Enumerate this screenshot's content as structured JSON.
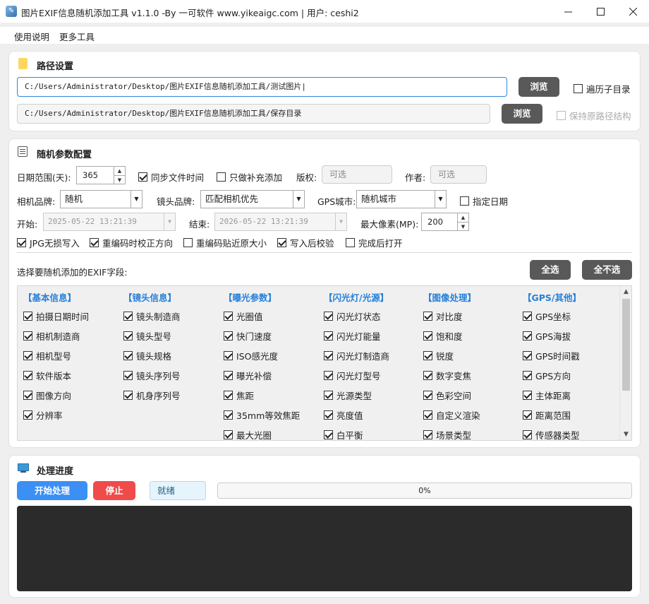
{
  "window": {
    "title": "图片EXIF信息随机添加工具 v1.1.0 -By 一可软件 www.yikeaigc.com  |  用户: ceshi2"
  },
  "menu": [
    "使用说明",
    "更多工具"
  ],
  "path_section": {
    "title": "路径设置",
    "input_path": "C:/Users/Administrator/Desktop/图片EXIF信息随机添加工具/测试图片|",
    "output_path": "C:/Users/Administrator/Desktop/图片EXIF信息随机添加工具/保存目录",
    "browse_label": "浏览",
    "browse2_label": "浏览",
    "traverse_label": "遍历子目录",
    "keep_structure_label": "保持原路径结构"
  },
  "params_section": {
    "title": "随机参数配置",
    "date_range_label": "日期范围(天):",
    "date_range_value": "365",
    "sync_file_time_label": "同步文件时间",
    "only_fill_label": "只做补充添加",
    "copyright_label": "版权:",
    "copyright_placeholder": "可选",
    "author_label": "作者:",
    "author_placeholder": "可选",
    "camera_brand_label": "相机品牌:",
    "camera_brand_value": "随机",
    "lens_brand_label": "镜头品牌:",
    "lens_brand_value": "匹配相机优先",
    "gps_city_label": "GPS城市:",
    "gps_city_value": "随机城市",
    "specify_date_label": "指定日期",
    "start_label": "开始:",
    "start_value": "2025-05-22 13:21:39",
    "end_label": "结束:",
    "end_value": "2026-05-22 13:21:39",
    "max_pixels_label": "最大像素(MP):",
    "max_pixels_value": "200",
    "opt_jpg_lossless": "JPG无损写入",
    "opt_reencode_orient": "重编码时校正方向",
    "opt_reencode_size": "重编码贴近原大小",
    "opt_verify": "写入后校验",
    "opt_open_after": "完成后打开",
    "fields_prompt": "选择要随机添加的EXIF字段:",
    "select_all": "全选",
    "select_none": "全不选"
  },
  "field_columns": [
    {
      "header": "【基本信息】",
      "items": [
        "拍摄日期时间",
        "相机制造商",
        "相机型号",
        "软件版本",
        "图像方向",
        "分辨率"
      ]
    },
    {
      "header": "【镜头信息】",
      "items": [
        "镜头制造商",
        "镜头型号",
        "镜头规格",
        "镜头序列号",
        "机身序列号"
      ]
    },
    {
      "header": "【曝光参数】",
      "items": [
        "光圈值",
        "快门速度",
        "ISO感光度",
        "曝光补偿",
        "焦距",
        "35mm等效焦距",
        "最大光圈"
      ]
    },
    {
      "header": "【闪光灯/光源】",
      "items": [
        "闪光灯状态",
        "闪光灯能量",
        "闪光灯制造商",
        "闪光灯型号",
        "光源类型",
        "亮度值",
        "白平衡"
      ]
    },
    {
      "header": "【图像处理】",
      "items": [
        "对比度",
        "饱和度",
        "锐度",
        "数字变焦",
        "色彩空间",
        "自定义渲染",
        "场景类型"
      ]
    },
    {
      "header": "【GPS/其他】",
      "items": [
        "GPS坐标",
        "GPS海拔",
        "GPS时间戳",
        "GPS方向",
        "主体距离",
        "距离范围",
        "传感器类型"
      ]
    }
  ],
  "progress_section": {
    "title": "处理进度",
    "start_label": "开始处理",
    "stop_label": "停止",
    "status_text": "就绪",
    "progress_text": "0%",
    "progress_value": 0
  },
  "colors": {
    "accent_blue": "#3b8ff5",
    "stop_red": "#f04b4b",
    "header_blue": "#2680d9",
    "dark_button": "#595959"
  }
}
